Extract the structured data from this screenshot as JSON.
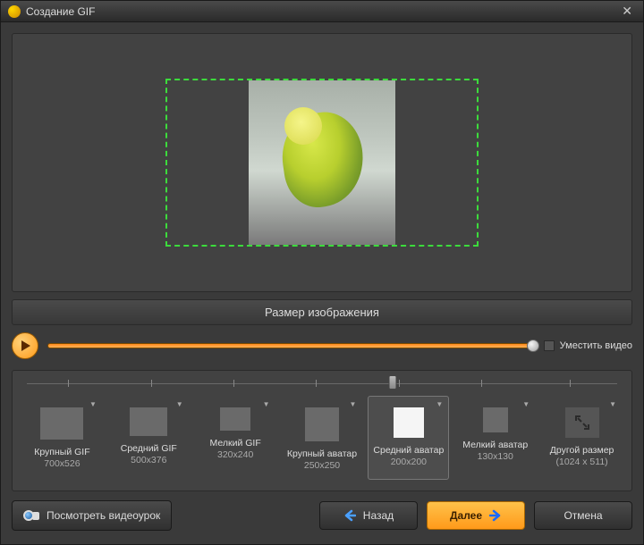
{
  "window": {
    "title": "Создание GIF"
  },
  "section": {
    "header": "Размер изображения"
  },
  "playback": {
    "fit_label": "Уместить видео"
  },
  "sizes": {
    "options": [
      {
        "label": "Крупный GIF",
        "dim": "700x526"
      },
      {
        "label": "Средний GIF",
        "dim": "500x376"
      },
      {
        "label": "Мелкий GIF",
        "dim": "320x240"
      },
      {
        "label": "Крупный аватар",
        "dim": "250x250"
      },
      {
        "label": "Средний аватар",
        "dim": "200x200"
      },
      {
        "label": "Мелкий аватар",
        "dim": "130x130"
      },
      {
        "label": "Другой размер",
        "dim": "(1024 x 511)"
      }
    ],
    "selected_index": 4
  },
  "footer": {
    "tutorial": "Посмотреть видеоурок",
    "back": "Назад",
    "next": "Далее",
    "cancel": "Отмена"
  }
}
